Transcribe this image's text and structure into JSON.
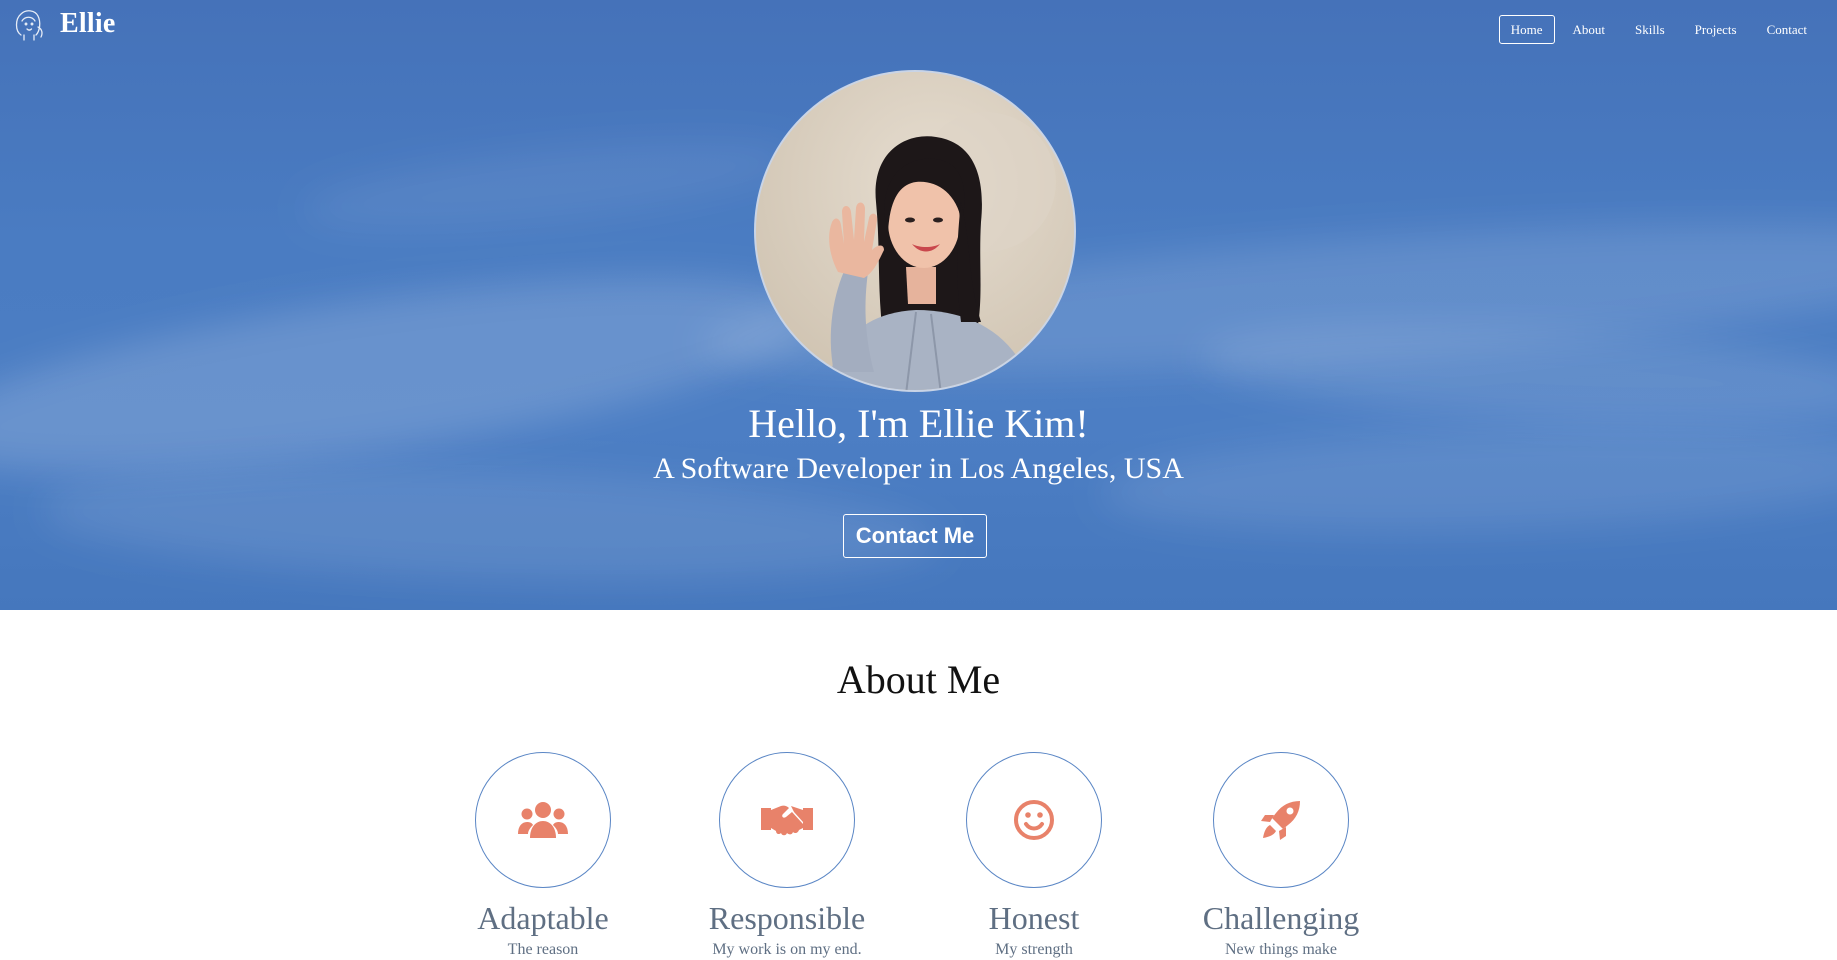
{
  "brand": {
    "name": "Ellie",
    "logo_icon": "girl-sketch-logo-icon"
  },
  "nav": {
    "items": [
      {
        "label": "Home",
        "active": true
      },
      {
        "label": "About",
        "active": false
      },
      {
        "label": "Skills",
        "active": false
      },
      {
        "label": "Projects",
        "active": false
      },
      {
        "label": "Contact",
        "active": false
      }
    ]
  },
  "hero": {
    "title": "Hello, I'm Ellie Kim!",
    "subtitle": "A Software Developer in Los Angeles, USA",
    "button_label": "Contact Me",
    "background_color": "#4a7cc2"
  },
  "about": {
    "title": "About Me",
    "accent_color": "#e8826a",
    "circle_border_color": "#5a86c5",
    "values": [
      {
        "icon": "users-icon",
        "title": "Adaptable",
        "desc": "The reason"
      },
      {
        "icon": "handshake-icon",
        "title": "Responsible",
        "desc": "My work is on my end."
      },
      {
        "icon": "smile-icon",
        "title": "Honest",
        "desc": "My strength"
      },
      {
        "icon": "rocket-icon",
        "title": "Challenging",
        "desc": "New things make"
      }
    ]
  }
}
